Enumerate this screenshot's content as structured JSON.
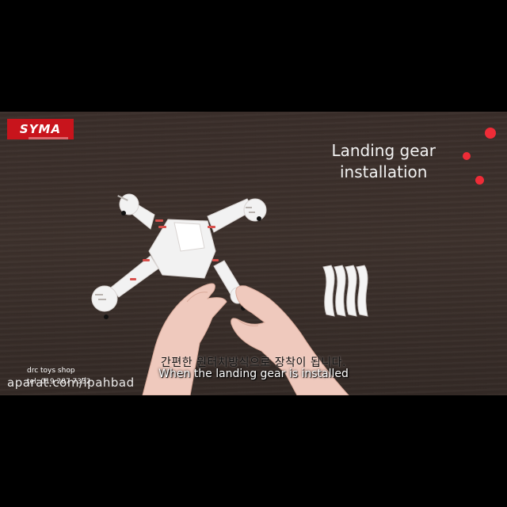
{
  "video": {
    "brand_logo": "SYMA",
    "title_lines": [
      "Landing gear",
      "installation"
    ],
    "subtitle_korean": "간편한 원터치방식으로 장착이 됩니다.",
    "subtitle_english": "When the landing gear is installed",
    "watermark_shop": "drc toys shop",
    "watermark_phone": "tel: 019 287 7332",
    "watermark_site": "aparat.com/ipahbad",
    "accent_color": "#ee2c37"
  }
}
